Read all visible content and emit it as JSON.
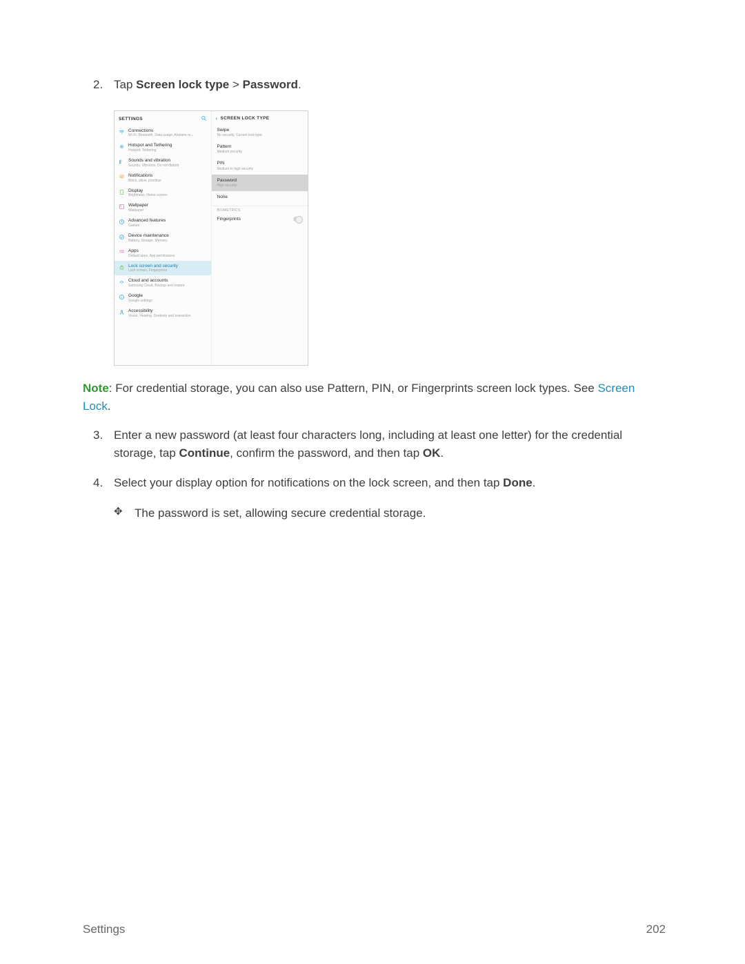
{
  "step2": {
    "number": "2.",
    "pre": "Tap ",
    "bold1": "Screen lock type",
    "mid": " > ",
    "bold2": "Password",
    "post": "."
  },
  "screenshot": {
    "leftHeader": "SETTINGS",
    "rightHeader": "SCREEN LOCK TYPE",
    "leftItems": [
      {
        "t": "Connections",
        "s": "Wi-Fi, Bluetooth, Data usage, Airplane m..."
      },
      {
        "t": "Hotspot and Tethering",
        "s": "Hotspot, Tethering"
      },
      {
        "t": "Sounds and vibration",
        "s": "Sounds, Vibration, Do not disturb"
      },
      {
        "t": "Notifications",
        "s": "Block, allow, prioritize"
      },
      {
        "t": "Display",
        "s": "Brightness, Home screen"
      },
      {
        "t": "Wallpaper",
        "s": "Wallpaper"
      },
      {
        "t": "Advanced features",
        "s": "Games"
      },
      {
        "t": "Device maintenance",
        "s": "Battery, Storage, Memory"
      },
      {
        "t": "Apps",
        "s": "Default apps, App permissions"
      },
      {
        "t": "Lock screen and security",
        "s": "Lock screen, Fingerprints"
      },
      {
        "t": "Cloud and accounts",
        "s": "Samsung Cloud, Backup and restore"
      },
      {
        "t": "Google",
        "s": "Google settings"
      },
      {
        "t": "Accessibility",
        "s": "Vision, Hearing, Dexterity and interaction"
      }
    ],
    "selectedLeftIndex": 9,
    "rightItems": [
      {
        "t": "Swipe",
        "s": "No security. Current lock type."
      },
      {
        "t": "Pattern",
        "s": "Medium security"
      },
      {
        "t": "PIN",
        "s": "Medium to high security"
      },
      {
        "t": "Password",
        "s": "High security"
      },
      {
        "t": "None",
        "s": ""
      }
    ],
    "highlightRightIndex": 3,
    "biometricsLabel": "BIOMETRICS",
    "fingerprintsLabel": "Fingerprints"
  },
  "note": {
    "label": "Note",
    "sep": ": ",
    "text": "For credential storage, you can also use Pattern, PIN, or Fingerprints screen lock types. See ",
    "link": "Screen Lock",
    "post": "."
  },
  "step3": {
    "number": "3.",
    "pre": "Enter a new password (at least four characters long, including at least one letter) for the credential storage, tap ",
    "bold1": "Continue",
    "mid": ", confirm the password, and then tap ",
    "bold2": "OK",
    "post": "."
  },
  "step4": {
    "number": "4.",
    "pre": "Select your display option for notifications on the lock screen, and then tap ",
    "bold1": "Done",
    "post": "."
  },
  "step4Sub": "The password is set, allowing secure credential storage.",
  "footer": {
    "section": "Settings",
    "page": "202"
  },
  "iconColors": [
    "#2aa7de",
    "#2aa7de",
    "#2aa7de",
    "#f2a94c",
    "#7cc26e",
    "#d97fbf",
    "#2aa7de",
    "#2aa7de",
    "#d97fbf",
    "#7cc26e",
    "#2aa7de",
    "#2aa7de",
    "#2aa7de"
  ]
}
